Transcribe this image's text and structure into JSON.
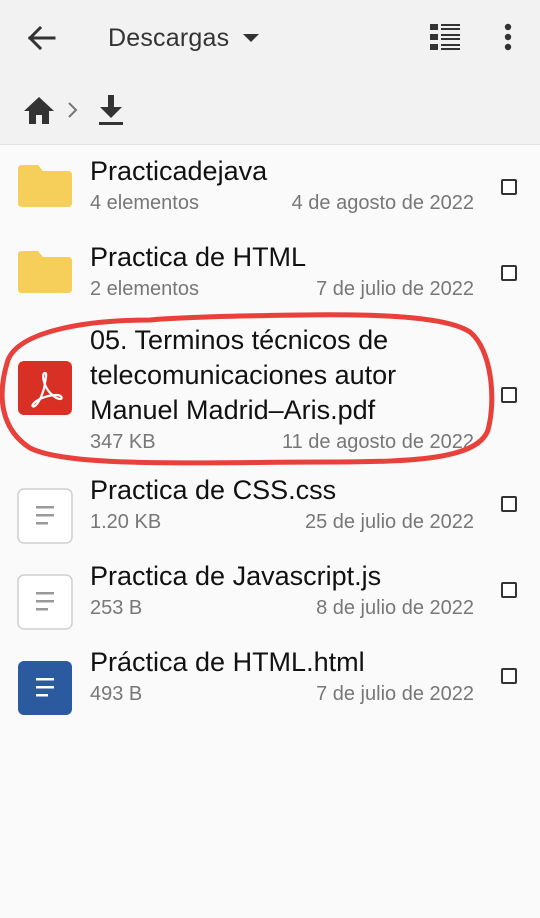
{
  "app_bar": {
    "title": "Descargas",
    "back_icon": "arrow-back-icon",
    "view_icon": "list-view-icon",
    "more_icon": "more-vert-icon"
  },
  "breadcrumb": {
    "items": [
      "home-icon",
      "download-icon"
    ]
  },
  "files": [
    {
      "name": "Practicadejava",
      "info": "4 elementos",
      "date": "4 de agosto de 2022",
      "icon": "folder-icon",
      "checked": false
    },
    {
      "name": "Practica de HTML",
      "info": "2 elementos",
      "date": "7 de julio de 2022",
      "icon": "folder-icon",
      "checked": false
    },
    {
      "name_lines": [
        "05. Terminos técnicos de",
        "telecomunicaciones autor",
        "Manuel Madrid–Aris.pdf"
      ],
      "info": "347 KB",
      "date": "11 de agosto de 2022",
      "icon": "pdf-icon",
      "checked": false
    },
    {
      "name": "Practica de CSS.css",
      "info": "1.20 KB",
      "date": "25 de julio de 2022",
      "icon": "text-file-icon",
      "checked": false
    },
    {
      "name": "Practica de Javascript.js",
      "info": "253 B",
      "date": "8 de julio de 2022",
      "icon": "text-file-icon",
      "checked": false
    },
    {
      "name": "Práctica de HTML.html",
      "info": "493 B",
      "date": "7 de julio de 2022",
      "icon": "document-icon",
      "checked": false
    }
  ],
  "colors": {
    "folder": "#f5cf5a",
    "pdf": "#d93025",
    "document": "#2b5a9e",
    "annotation": "#e8403a"
  }
}
